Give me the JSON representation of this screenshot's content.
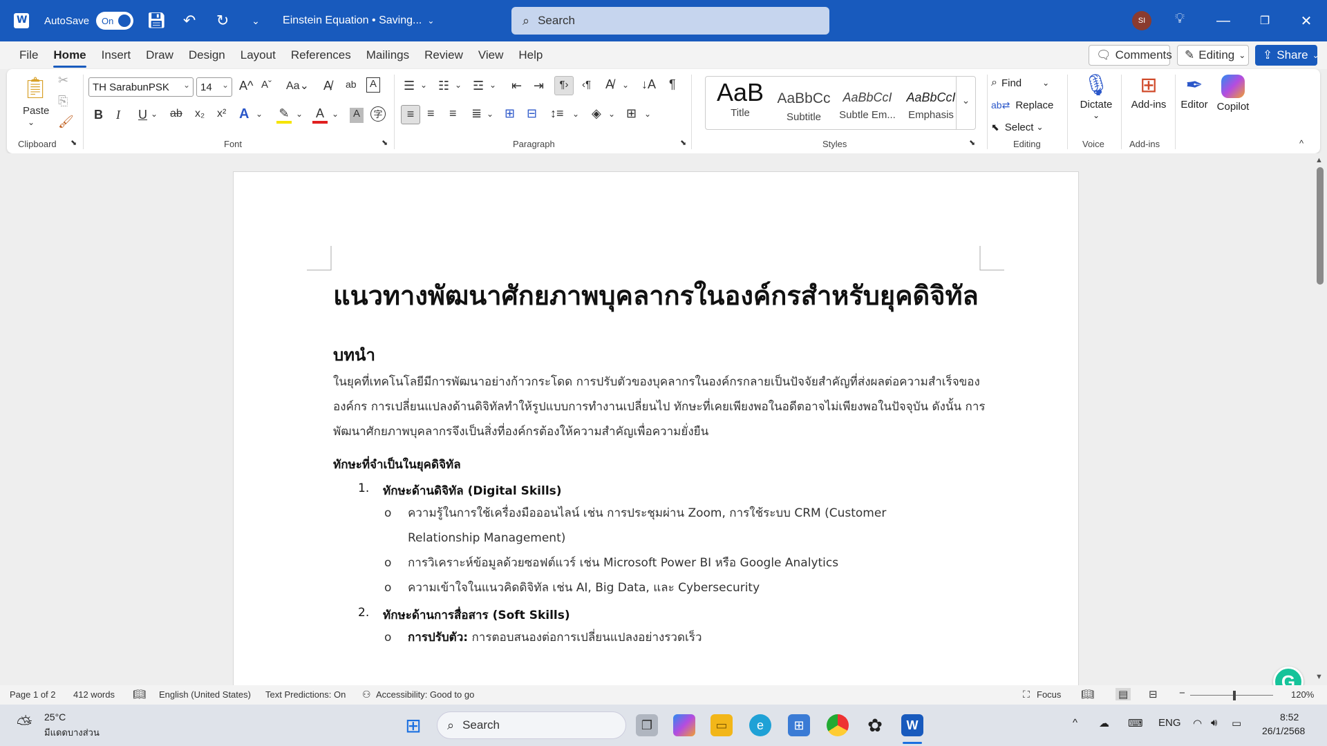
{
  "titlebar": {
    "autosave_label": "AutoSave",
    "autosave_state": "On",
    "doc_title": "Einstein Equation • Saving...",
    "search_placeholder": "Search",
    "avatar_initials": "SI"
  },
  "menu": {
    "tabs": [
      "File",
      "Home",
      "Insert",
      "Draw",
      "Design",
      "Layout",
      "References",
      "Mailings",
      "Review",
      "View",
      "Help"
    ],
    "active_tab": "Home",
    "comments_label": "Comments",
    "editing_label": "Editing",
    "share_label": "Share"
  },
  "ribbon": {
    "clipboard": {
      "paste_label": "Paste",
      "group_label": "Clipboard"
    },
    "font": {
      "font_name": "TH SarabunPSK",
      "font_size": "14",
      "group_label": "Font"
    },
    "paragraph": {
      "group_label": "Paragraph"
    },
    "styles": {
      "group_label": "Styles",
      "items": [
        {
          "sample": "AaB",
          "name": "Title"
        },
        {
          "sample": "AaBbCc",
          "name": "Subtitle"
        },
        {
          "sample": "AaBbCcI",
          "name": "Subtle Em..."
        },
        {
          "sample": "AaBbCcI",
          "name": "Emphasis"
        }
      ]
    },
    "editing": {
      "find_label": "Find",
      "replace_label": "Replace",
      "select_label": "Select",
      "group_label": "Editing"
    },
    "voice": {
      "dictate_label": "Dictate",
      "group_label": "Voice"
    },
    "addins": {
      "addins_label": "Add-ins",
      "group_label": "Add-ins"
    },
    "editor_label": "Editor",
    "copilot_label": "Copilot"
  },
  "document": {
    "title": "แนวทางพัฒนาศักยภาพบุคลากรในองค์กรสำหรับยุคดิจิทัล",
    "intro_heading": "บทนำ",
    "intro_paragraph": "ในยุคที่เทคโนโลยีมีการพัฒนาอย่างก้าวกระโดด การปรับตัวของบุคลากรในองค์กรกลายเป็นปัจจัยสำคัญที่ส่งผลต่อความสำเร็จขององค์กร การเปลี่ยนแปลงด้านดิจิทัลทำให้รูปแบบการทำงานเปลี่ยนไป ทักษะที่เคยเพียงพอในอดีตอาจไม่เพียงพอในปัจจุบัน ดังนั้น การพัฒนาศักยภาพบุคลากรจึงเป็นสิ่งที่องค์กรต้องให้ความสำคัญเพื่อความยั่งยืน",
    "skills_heading": "ทักษะที่จำเป็นในยุคดิจิทัล",
    "item1_num": "1.",
    "item1_title": "ทักษะด้านดิจิทัล (Digital Skills)",
    "item1_bullets": [
      "ความรู้ในการใช้เครื่องมือออนไลน์ เช่น การประชุมผ่าน Zoom, การใช้ระบบ CRM (Customer",
      "Relationship Management)",
      "การวิเคราะห์ข้อมูลด้วยซอฟต์แวร์ เช่น Microsoft Power BI หรือ Google Analytics",
      "ความเข้าใจในแนวคิดดิจิทัล เช่น AI, Big Data, และ Cybersecurity"
    ],
    "item2_num": "2.",
    "item2_title": "ทักษะด้านการสื่อสาร (Soft Skills)",
    "item2_bullet_bold": "การปรับตัว:",
    "item2_bullet_rest": " การตอบสนองต่อการเปลี่ยนแปลงอย่างรวดเร็ว"
  },
  "statusbar": {
    "page": "Page 1 of 2",
    "words": "412 words",
    "language": "English (United States)",
    "predictions": "Text Predictions: On",
    "accessibility": "Accessibility: Good to go",
    "focus": "Focus",
    "zoom": "120%"
  },
  "taskbar": {
    "weather_temp": "25°C",
    "weather_desc": "มีแดดบางส่วน",
    "search_label": "Search",
    "lang": "ENG",
    "time": "8:52",
    "date": "26/1/2568"
  }
}
